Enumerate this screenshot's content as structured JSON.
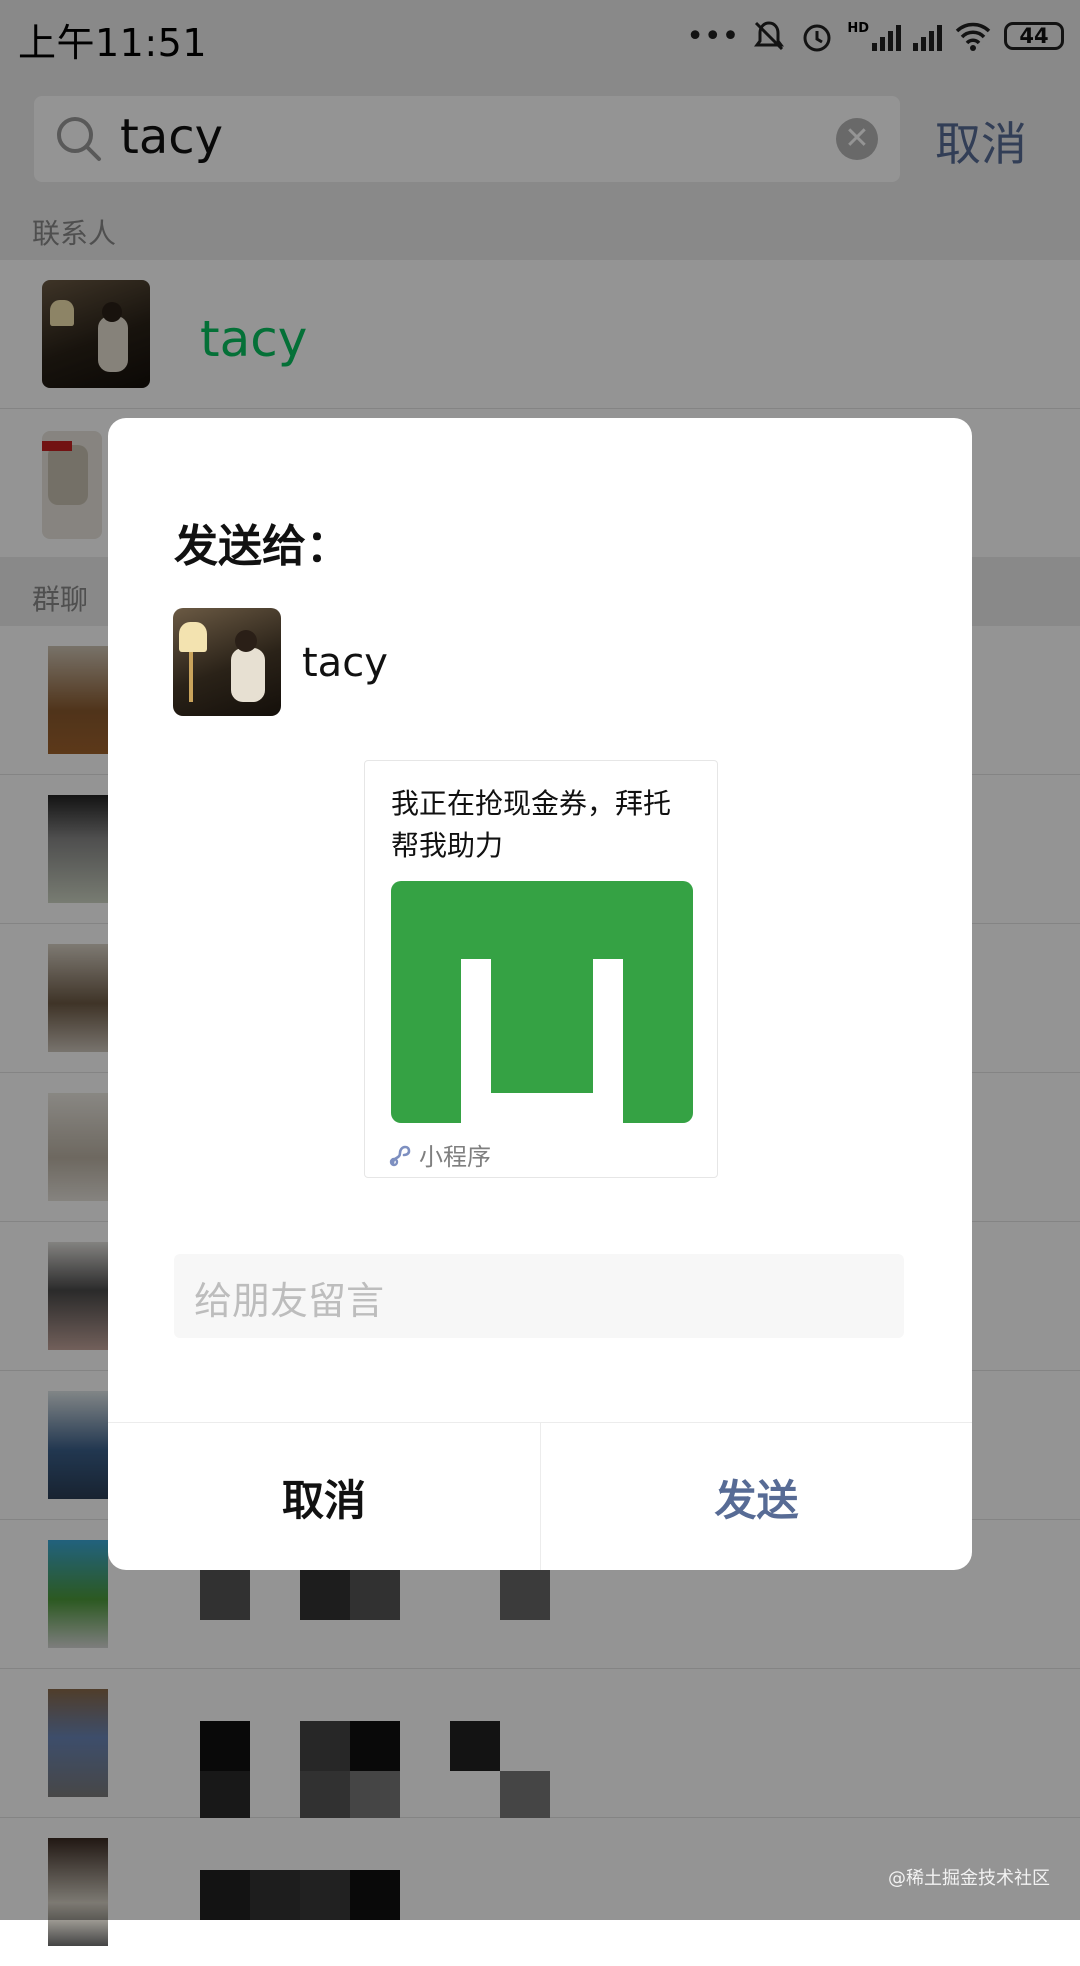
{
  "status_bar": {
    "time": "上午11:51",
    "battery": "44",
    "network": "HD"
  },
  "search": {
    "query": "tacy",
    "cancel_label": "取消"
  },
  "sections": {
    "contacts_label": "联系人",
    "groups_label": "群聊"
  },
  "contacts": [
    {
      "name": "tacy"
    }
  ],
  "dialog": {
    "title": "发送给：",
    "recipient_name": "tacy",
    "card": {
      "text": "我正在抢现金券，拜托帮我助力",
      "source_label": "小程序",
      "image_color": "#35a244"
    },
    "message_placeholder": "给朋友留言",
    "cancel_label": "取消",
    "send_label": "发送"
  },
  "watermark": "@稀土掘金技术社区",
  "colors": {
    "accent": "#576b95",
    "contact_name": "#07c160",
    "card_green": "#35a244"
  }
}
